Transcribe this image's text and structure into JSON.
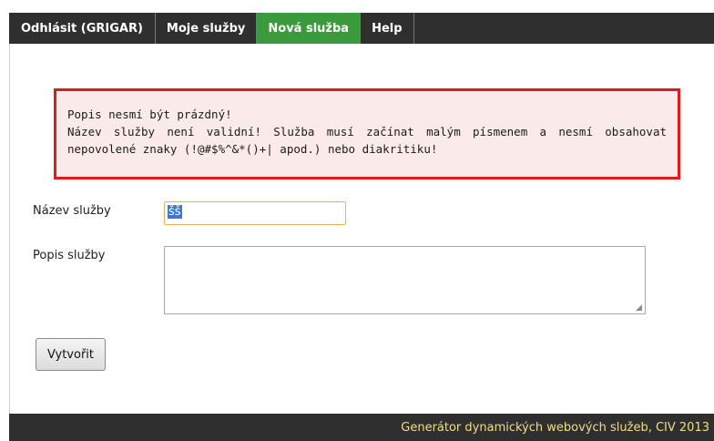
{
  "nav": {
    "items": [
      {
        "label": "Odhlásit (GRIGAR)",
        "active": false
      },
      {
        "label": "Moje služby",
        "active": false
      },
      {
        "label": "Nová služba",
        "active": true
      },
      {
        "label": "Help",
        "active": false
      }
    ]
  },
  "errors": {
    "line1": "Popis nesmí být prázdný!",
    "line2": "Název služby není validní! Služba musí začínat malým písmenem a nesmí obsahovat nepovolené znaky (!@#$%^&*()+| apod.) nebo diakritiku!"
  },
  "form": {
    "name_label": "Název služby",
    "name_value": "šš",
    "desc_label": "Popis služby",
    "desc_value": "",
    "submit_label": "Vytvořit"
  },
  "footer": {
    "text": "Generátor dynamických webových služeb, CIV 2013"
  },
  "colors": {
    "nav_bg": "#2f2f2f",
    "nav_active": "#3b9a3b",
    "error_border": "#e01b1b",
    "error_bg": "#fbeaea",
    "footer_text": "#f2dc8a"
  }
}
